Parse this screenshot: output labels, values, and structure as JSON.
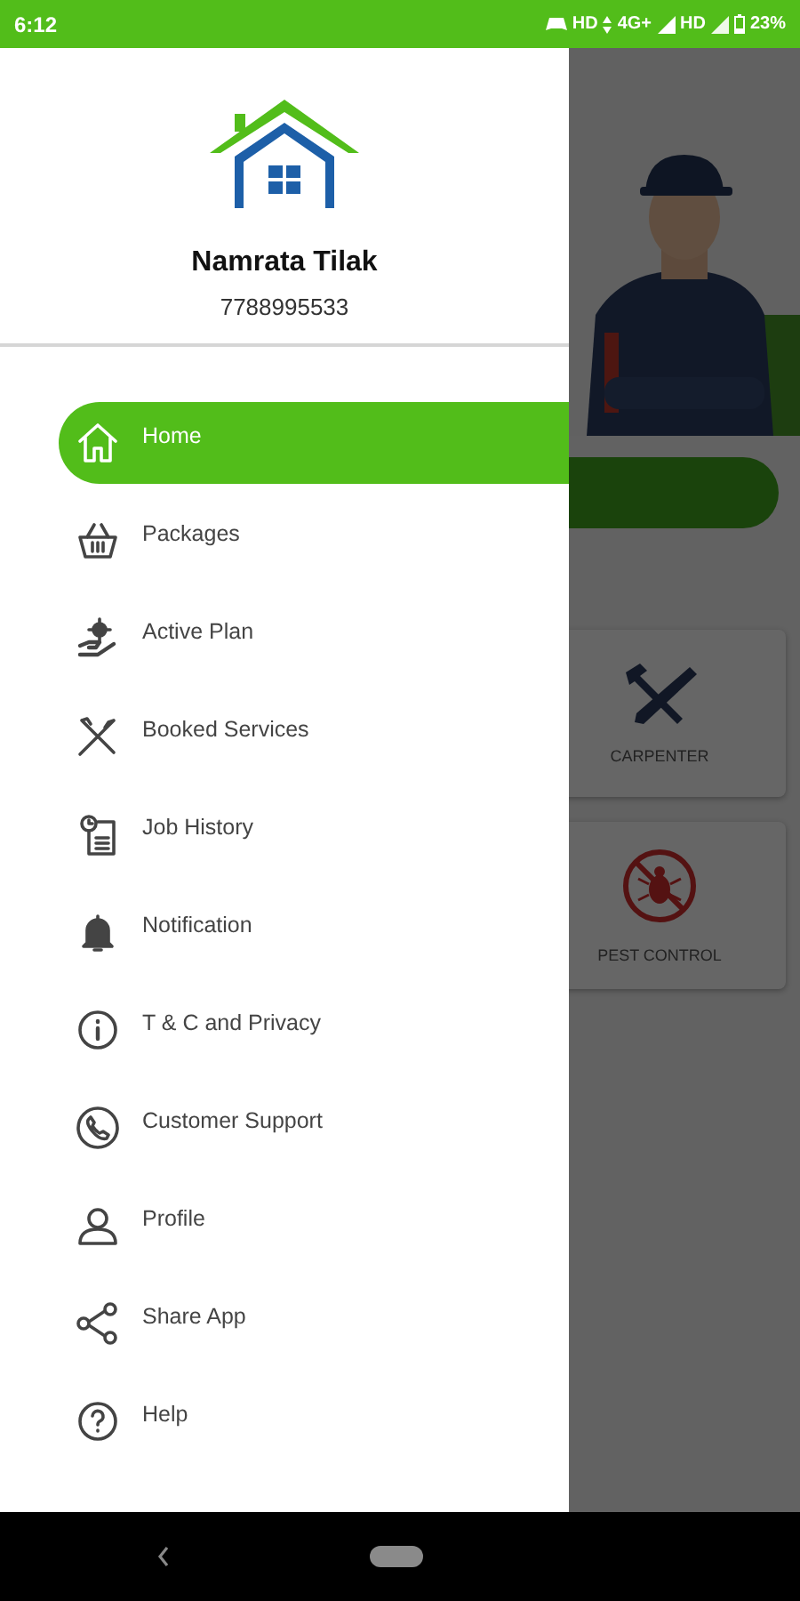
{
  "status_bar": {
    "time": "6:12",
    "network_1": "HD",
    "network_2": "4G+",
    "network_3": "HD",
    "battery": "23%"
  },
  "drawer": {
    "user_name": "Namrata Tilak",
    "phone": "7788995533",
    "items": [
      {
        "label": "Home",
        "selected": true
      },
      {
        "label": "Packages",
        "selected": false
      },
      {
        "label": "Active Plan",
        "selected": false
      },
      {
        "label": "Booked Services",
        "selected": false
      },
      {
        "label": "Job History",
        "selected": false
      },
      {
        "label": "Notification",
        "selected": false
      },
      {
        "label": "T & C and Privacy",
        "selected": false
      },
      {
        "label": "Customer Support",
        "selected": false
      },
      {
        "label": "Profile",
        "selected": false
      },
      {
        "label": "Share App",
        "selected": false
      },
      {
        "label": "Help",
        "selected": false
      }
    ]
  },
  "background": {
    "service_cards": [
      {
        "label": "CARPENTER"
      },
      {
        "label": "PEST CONTROL"
      }
    ]
  }
}
